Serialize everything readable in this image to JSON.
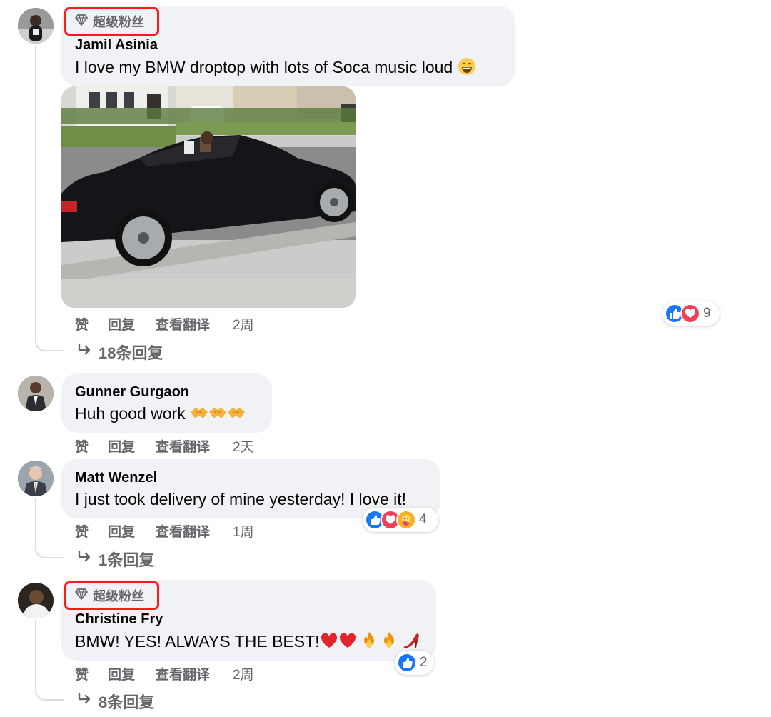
{
  "fan_badge_label": "超级粉丝",
  "actions": {
    "like": "赞",
    "reply": "回复",
    "translate": "查看翻译"
  },
  "comments": [
    {
      "author": "Jamil Asinia",
      "text": "I love my BMW droptop with lots of Soca music loud",
      "emoji": "grinning-face",
      "time": "2周",
      "reactions": {
        "count": "9",
        "types": [
          "like",
          "love"
        ]
      },
      "replies": "18条回复",
      "photo": "black-bmw-convertible-photo"
    },
    {
      "author": "Gunner Gurgaon",
      "text": "Huh good work",
      "emoji": "handshake ×3",
      "time": "2天"
    },
    {
      "author": "Matt Wenzel",
      "text": "I just took delivery of mine yesterday! I love it!",
      "time": "1周",
      "reactions": {
        "count": "4",
        "types": [
          "like",
          "love",
          "care"
        ]
      },
      "replies": "1条回复"
    },
    {
      "author": "Christine Fry",
      "text": "BMW! YES! ALWAYS THE BEST!",
      "emoji": "red-heart ×2, fire ×2, high-heel",
      "time": "2周",
      "reactions": {
        "count": "2",
        "types": [
          "like"
        ]
      },
      "replies": "8条回复"
    }
  ],
  "colors": {
    "like_blue": "#1877f2",
    "love_red": "#f33e58",
    "bubble": "#f0f2f5",
    "meta_gray": "#65676b",
    "badge_border": "#ff1a1a"
  }
}
